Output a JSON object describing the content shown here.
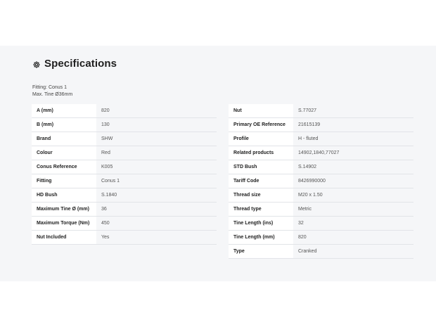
{
  "section": {
    "icon": "gear-icon",
    "title": "Specifications",
    "notes": [
      "Fitting: Conus 1",
      "Max. Tine Ø36mm"
    ]
  },
  "left_table": [
    {
      "key": "A (mm)",
      "value": "820"
    },
    {
      "key": "B (mm)",
      "value": "130"
    },
    {
      "key": "Brand",
      "value": "SHW"
    },
    {
      "key": "Colour",
      "value": "Red"
    },
    {
      "key": "Conus Reference",
      "value": "K005"
    },
    {
      "key": "Fitting",
      "value": "Conus 1"
    },
    {
      "key": "HD Bush",
      "value": "S.1840"
    },
    {
      "key": "Maximum Tine Ø (mm)",
      "value": "36"
    },
    {
      "key": "Maximum Torque (Nm)",
      "value": "450"
    },
    {
      "key": "Nut Included",
      "value": "Yes"
    }
  ],
  "right_table": [
    {
      "key": "Nut",
      "value": "S.77027"
    },
    {
      "key": "Primary OE Reference",
      "value": "21615139"
    },
    {
      "key": "Profile",
      "value": "H - fluted"
    },
    {
      "key": "Related products",
      "value": "14902,1840,77027"
    },
    {
      "key": "STD Bush",
      "value": "S.14902"
    },
    {
      "key": "Tariff Code",
      "value": "8426990000"
    },
    {
      "key": "Thread size",
      "value": "M20 x 1.50"
    },
    {
      "key": "Thread type",
      "value": "Metric"
    },
    {
      "key": "Tine Length (ins)",
      "value": "32"
    },
    {
      "key": "Tine Length (mm)",
      "value": "820"
    },
    {
      "key": "Type",
      "value": "Cranked"
    }
  ]
}
